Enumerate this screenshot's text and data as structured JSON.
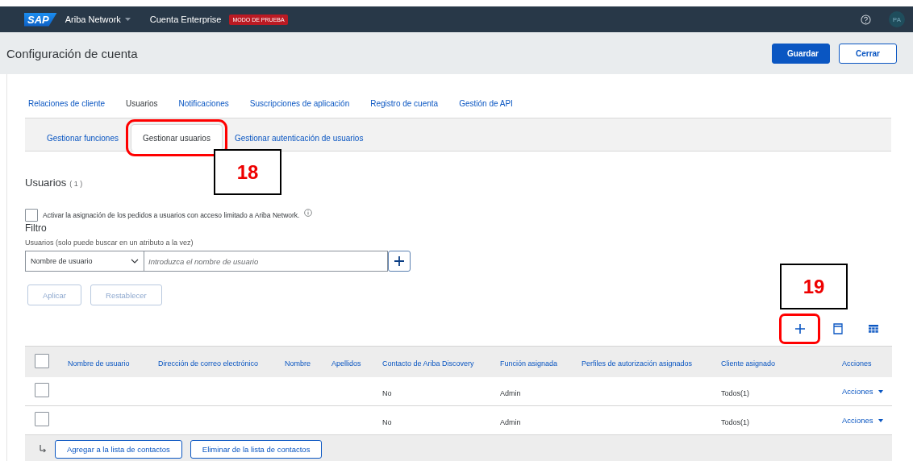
{
  "top_bar": {
    "brand": "SAP",
    "product": "Ariba Network",
    "account": "Cuenta Enterprise",
    "badge": "MODO DE PRUEBA",
    "avatar": "PA"
  },
  "header": {
    "title": "Configuración de cuenta",
    "buttons": [
      {
        "label": "Guardar",
        "kind": "primary"
      },
      {
        "label": "Cerrar",
        "kind": "secondary"
      }
    ]
  },
  "tabs": [
    {
      "label": "Relaciones de cliente",
      "selected": false
    },
    {
      "label": "Usuarios",
      "selected": true
    },
    {
      "label": "Notificaciones",
      "selected": false
    },
    {
      "label": "Suscripciones de aplicación",
      "selected": false
    },
    {
      "label": "Registro de cuenta",
      "selected": false
    },
    {
      "label": "Gestión de API",
      "selected": false
    }
  ],
  "subtabs": [
    {
      "label": "Gestionar funciones",
      "selected": false,
      "highlighted": false
    },
    {
      "label": "Gestionar usuarios",
      "selected": true,
      "highlighted": true
    },
    {
      "label": "Gestionar autenticación de usuarios",
      "selected": false,
      "highlighted": false
    }
  ],
  "section": {
    "title": "Usuarios",
    "count": "( 1 )"
  },
  "option": {
    "label": "Activar la asignación de los pedidos a usuarios con acceso limitado a Ariba Network.",
    "checked": false
  },
  "filter": {
    "title": "Filtro",
    "hint": "Usuarios (solo puede buscar en un atributo a la vez)",
    "attribute": "Nombre de usuario",
    "placeholder": "Introduzca el nombre de usuario"
  },
  "filter_buttons": [
    {
      "label": "Aplicar",
      "disabled": true
    },
    {
      "label": "Restablecer",
      "disabled": true
    }
  ],
  "toolbar": [
    {
      "kind": "add",
      "highlighted": true
    },
    {
      "kind": "panel",
      "highlighted": false
    },
    {
      "kind": "grid",
      "highlighted": false
    }
  ],
  "table": {
    "select_all": {
      "checked": false
    },
    "columns": [
      "Nombre de usuario",
      "Dirección de correo electrónico",
      "Nombre",
      "Apellidos",
      "Contacto de Ariba Discovery",
      "Función asignada",
      "Perfiles de autorización asignados",
      "Cliente asignado",
      "Acciones"
    ],
    "rows": [
      {
        "checked": false,
        "cells": [
          null,
          null,
          null,
          null,
          "No",
          "Admin",
          null,
          "Todos(1)",
          "Acciones"
        ]
      },
      {
        "checked": false,
        "cells": [
          null,
          null,
          null,
          null,
          "No",
          "Admin",
          null,
          "Todos(1)",
          "Acciones"
        ]
      }
    ]
  },
  "footer_actions": [
    "Agregar a la lista de contactos",
    "Eliminar de la lista de contactos"
  ],
  "callouts": [
    {
      "label": "18"
    },
    {
      "label": "19"
    }
  ]
}
